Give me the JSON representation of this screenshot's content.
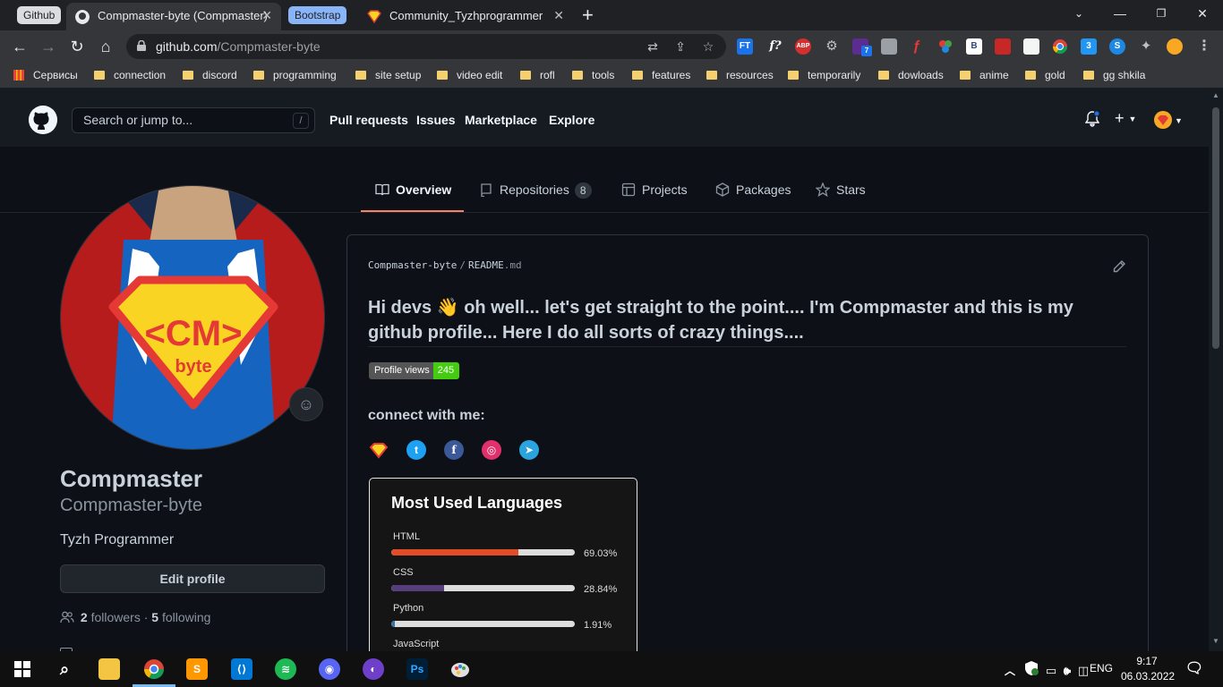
{
  "browser": {
    "tab_groups": [
      {
        "label": "Github"
      },
      {
        "label": "Bootstrap"
      }
    ],
    "tabs": [
      {
        "title": "Compmaster-byte (Compmaster)",
        "active": true
      },
      {
        "title": "Community_Tyzhprogrammer",
        "active": false
      }
    ],
    "new_tab_symbol": "+",
    "url_domain": "github.com",
    "url_path": "/Compmaster-byte",
    "extensions": [
      "FT",
      "f?",
      "ABP",
      "gear",
      "7",
      "shield",
      "flash",
      "B",
      "gift",
      "chrome",
      "css3",
      "shazam",
      "puzzle",
      "avatar"
    ],
    "bookmarks": [
      {
        "label": "Сервисы",
        "type": "apps"
      },
      {
        "label": "connection",
        "type": "folder"
      },
      {
        "label": "discord",
        "type": "folder"
      },
      {
        "label": "programming",
        "type": "folder"
      },
      {
        "label": "site setup",
        "type": "folder"
      },
      {
        "label": "video edit",
        "type": "folder"
      },
      {
        "label": "rofl",
        "type": "folder"
      },
      {
        "label": "tools",
        "type": "folder"
      },
      {
        "label": "features",
        "type": "folder"
      },
      {
        "label": "resources",
        "type": "folder"
      },
      {
        "label": "temporarily",
        "type": "folder"
      },
      {
        "label": "dowloads",
        "type": "folder"
      },
      {
        "label": "anime",
        "type": "folder"
      },
      {
        "label": "gold",
        "type": "folder"
      },
      {
        "label": "gg shkila",
        "type": "folder"
      }
    ]
  },
  "github": {
    "search_placeholder": "Search or jump to...",
    "search_shortcut": "/",
    "nav": [
      "Pull requests",
      "Issues",
      "Marketplace",
      "Explore"
    ],
    "profile_tabs": [
      {
        "label": "Overview",
        "icon": "book-icon",
        "active": true
      },
      {
        "label": "Repositories",
        "icon": "repo-icon",
        "count": "8"
      },
      {
        "label": "Projects",
        "icon": "project-icon"
      },
      {
        "label": "Packages",
        "icon": "package-icon"
      },
      {
        "label": "Stars",
        "icon": "star-icon"
      }
    ],
    "profile": {
      "avatar_text_main": "<CM>",
      "avatar_text_sub": "byte",
      "name": "Compmaster",
      "login": "Compmaster-byte",
      "bio": "Tyzh Programmer",
      "edit_label": "Edit profile",
      "followers_count": "2",
      "followers_label": "followers",
      "separator": "·",
      "following_count": "5",
      "following_label": "following"
    },
    "readme": {
      "owner": "Compmaster-byte",
      "path_separator": "/",
      "file_base": "README",
      "file_ext": ".md",
      "heading_part1": "Hi devs",
      "heading_emoji": "👋",
      "heading_part2": "oh well... let's get straight to the point.... I'm Compmaster and this is my github profile... Here I do all sorts of crazy things....",
      "badge_label": "Profile views",
      "badge_value": "245",
      "connect_label": "connect with me:",
      "socials": [
        "superhero",
        "twitter",
        "facebook",
        "instagram",
        "telegram"
      ],
      "languages_card": {
        "title": "Most Used Languages",
        "languages": [
          {
            "name": "HTML",
            "percent": "69.03%",
            "value": 69.03,
            "color": "#e34c26"
          },
          {
            "name": "CSS",
            "percent": "28.84%",
            "value": 28.84,
            "color": "#563d7c"
          },
          {
            "name": "Python",
            "percent": "1.91%",
            "value": 1.91,
            "color": "#3572A5"
          },
          {
            "name": "JavaScript",
            "percent": "",
            "value": 0,
            "color": "#f1e05a"
          }
        ]
      }
    }
  },
  "taskbar": {
    "apps": [
      "chrome",
      "sublime",
      "vscode",
      "spotify",
      "discord",
      "github-desktop",
      "photoshop",
      "paint"
    ],
    "language": "ENG",
    "time": "9:17",
    "date": "06.03.2022"
  }
}
